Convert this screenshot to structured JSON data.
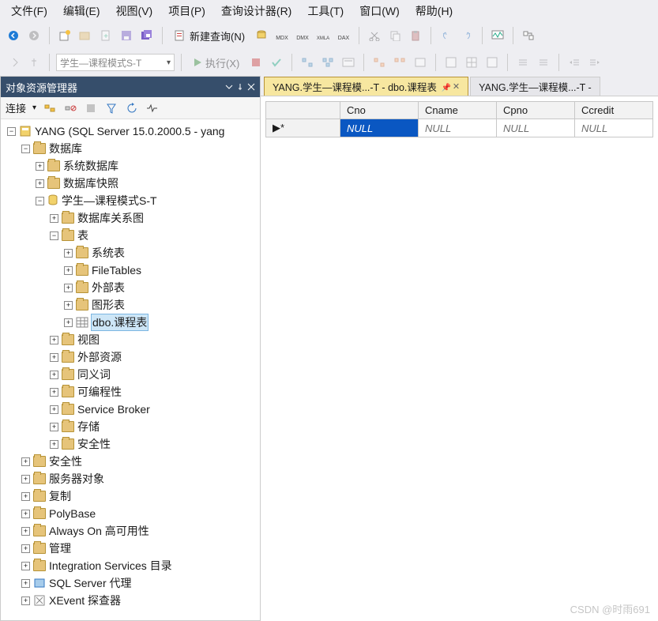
{
  "menu": {
    "file": "文件(F)",
    "edit": "编辑(E)",
    "view": "视图(V)",
    "project": "项目(P)",
    "query_designer": "查询设计器(R)",
    "tools": "工具(T)",
    "window": "窗口(W)",
    "help": "帮助(H)"
  },
  "toolbar": {
    "new_query": "新建查询(N)",
    "execute": "执行(X)",
    "combo_display": "学生—课程模式S-T"
  },
  "panel": {
    "title": "对象资源管理器",
    "connect": "连接"
  },
  "tree": {
    "server": "YANG (SQL Server 15.0.2000.5 - yang",
    "databases": "数据库",
    "sys_db": "系统数据库",
    "db_snapshot": "数据库快照",
    "user_db": "学生—课程模式S-T",
    "db_diagram": "数据库关系图",
    "tables": "表",
    "sys_tables": "系统表",
    "filetables": "FileTables",
    "ext_tables": "外部表",
    "graph_tables": "图形表",
    "dbo_course": "dbo.课程表",
    "views": "视图",
    "ext_res": "外部资源",
    "synonyms": "同义词",
    "programmability": "可编程性",
    "service_broker": "Service Broker",
    "storage": "存储",
    "db_security": "安全性",
    "security": "安全性",
    "server_objects": "服务器对象",
    "replication": "复制",
    "polybase": "PolyBase",
    "always_on": "Always On 高可用性",
    "management": "管理",
    "integration": "Integration Services 目录",
    "sql_agent": "SQL Server 代理",
    "xevent": "XEvent 探查器"
  },
  "tabs": {
    "active": "YANG.学生—课程模...-T - dbo.课程表",
    "inactive": "YANG.学生—课程模...-T -"
  },
  "grid": {
    "row_marker": "▶*",
    "columns": [
      "Cno",
      "Cname",
      "Cpno",
      "Ccredit"
    ],
    "row": [
      "NULL",
      "NULL",
      "NULL",
      "NULL"
    ]
  },
  "watermark": "CSDN @时雨691"
}
